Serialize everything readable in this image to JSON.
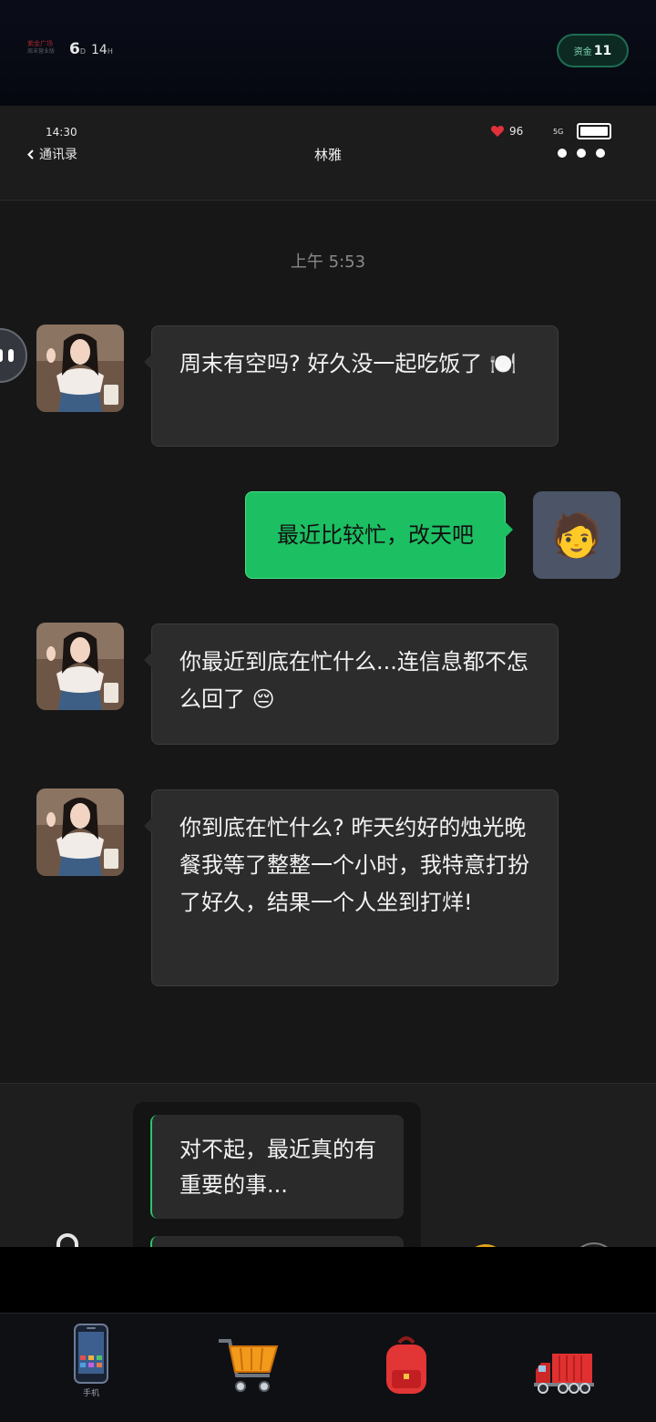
{
  "game": {
    "logo_text_1": "紫金广场",
    "logo_text_2": "周末营业版",
    "day_value": "6",
    "day_unit": "D",
    "hour_value": "14",
    "hour_unit": "H",
    "fund_label": "资金",
    "fund_value": "11"
  },
  "phone": {
    "status": {
      "time": "14:30",
      "battery": "96",
      "network": "5G"
    },
    "header": {
      "back_label": "通讯录",
      "title": "林雅"
    },
    "timestamp": "上午 5:53",
    "messages": [
      {
        "from": "contact",
        "text": "周末有空吗? 好久没一起吃饭了 🍽️"
      },
      {
        "from": "me",
        "text": "最近比较忙，改天吧"
      },
      {
        "from": "contact",
        "text": "你最近到底在忙什么...连信息都不怎么回了 😔"
      },
      {
        "from": "contact",
        "text": "你到底在忙什么? 昨天约好的烛光晚餐我等了整整一个小时，我特意打扮了好久，结果一个人坐到打烊!"
      }
    ],
    "me_avatar_emoji": "🧑",
    "reply_options": [
      "对不起，最近真的有重要的事...",
      ""
    ]
  },
  "nav": {
    "items": [
      {
        "label": "手机",
        "icon": "phone-icon",
        "active": true
      },
      {
        "label": "",
        "icon": "cart-icon",
        "active": false
      },
      {
        "label": "",
        "icon": "backpack-icon",
        "active": false
      },
      {
        "label": "",
        "icon": "truck-icon",
        "active": false
      }
    ]
  },
  "colors": {
    "accent_green": "#1dbf63",
    "fund_border": "#1d6d52",
    "bubble_bg": "#2c2c2c"
  }
}
